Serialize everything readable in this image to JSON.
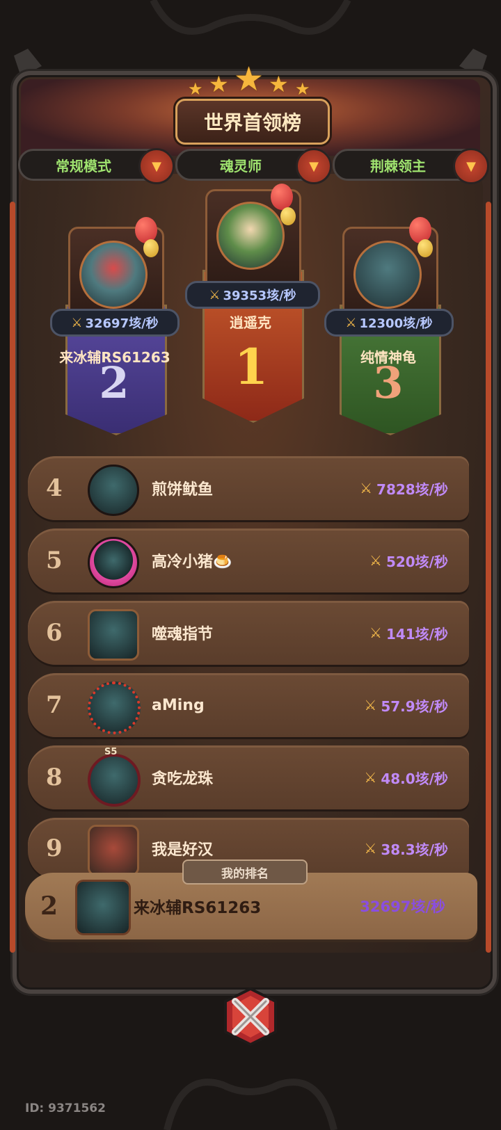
{
  "title": "世界首领榜",
  "filters": [
    {
      "label": "常规模式"
    },
    {
      "label": "魂灵师"
    },
    {
      "label": "荆棘领主"
    }
  ],
  "podium": {
    "first": {
      "rank": "1",
      "name": "逍遥克",
      "score": "39353垓/秒"
    },
    "second": {
      "rank": "2",
      "name": "来冰辅RS61263",
      "score": "32697垓/秒"
    },
    "third": {
      "rank": "3",
      "name": "纯情神龟",
      "score": "12300垓/秒"
    }
  },
  "list": [
    {
      "rank": "4",
      "name": "煎饼鱿鱼",
      "score": "7828垓/秒"
    },
    {
      "rank": "5",
      "name": "高冷小猪🍮",
      "score": "520垓/秒"
    },
    {
      "rank": "6",
      "name": "噬魂指节",
      "score": "141垓/秒"
    },
    {
      "rank": "7",
      "name": "aMing",
      "score": "57.9垓/秒"
    },
    {
      "rank": "8",
      "name": "贪吃龙珠",
      "score": "48.0垓/秒",
      "badge": "S5"
    },
    {
      "rank": "9",
      "name": "我是好汉",
      "score": "38.3垓/秒"
    }
  ],
  "my_rank": {
    "tag": "我的排名",
    "rank": "2",
    "name": "来冰辅RS61263",
    "score": "32697垓/秒"
  },
  "footer": {
    "id": "ID: 9371562"
  },
  "colors": {
    "score_purple": "#c08af7",
    "filter_green": "#9fe36f",
    "first_red": "#c4442a",
    "second_purple": "#4f3d8d",
    "third_green": "#3f6b34"
  }
}
